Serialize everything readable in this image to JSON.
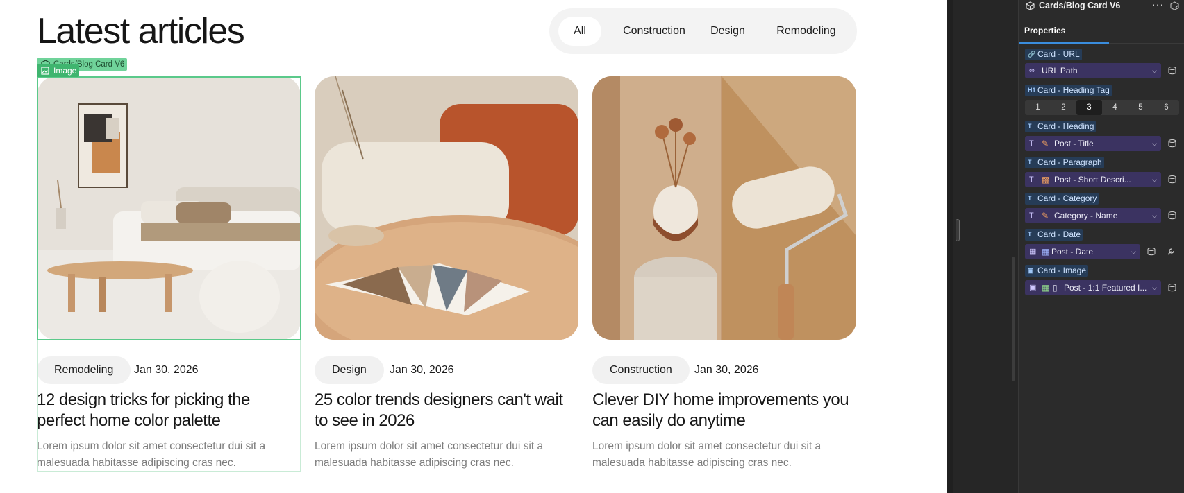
{
  "canvas": {
    "title": "Latest articles",
    "filters": [
      {
        "label": "All",
        "active": true
      },
      {
        "label": "Construction",
        "active": false
      },
      {
        "label": "Design",
        "active": false
      },
      {
        "label": "Remodeling",
        "active": false
      }
    ],
    "cards": [
      {
        "category": "Remodeling",
        "date": "Jan 30, 2026",
        "heading": "12 design tricks for picking the perfect home color palette",
        "paragraph": "Lorem ipsum dolor sit amet consectetur dui sit a malesuada habitasse adipiscing cras nec."
      },
      {
        "category": "Design",
        "date": "Jan 30, 2026",
        "heading": "25 color trends designers can't wait to see in 2026",
        "paragraph": "Lorem ipsum dolor sit amet consectetur dui sit a malesuada habitasse adipiscing cras nec."
      },
      {
        "category": "Construction",
        "date": "Jan 30, 2026",
        "heading": "Clever DIY home improvements you can easily do anytime",
        "paragraph": "Lorem ipsum dolor sit amet consectetur dui sit a malesuada habitasse adipiscing cras nec."
      }
    ],
    "selection": {
      "component_tag": "Cards/Blog Card V6",
      "element_tag": "Image"
    }
  },
  "panel": {
    "component_name": "Cards/Blog Card V6",
    "more_label": "···",
    "tab": "Properties",
    "heading_tag_options": [
      "1",
      "2",
      "3",
      "4",
      "5",
      "6"
    ],
    "heading_tag_selected": "3",
    "props": {
      "url": {
        "label": "Card - URL",
        "value": "URL Path"
      },
      "heading_tag": {
        "label": "Card - Heading Tag",
        "prefix": "H1"
      },
      "heading": {
        "label": "Card - Heading",
        "value": "Post - Title"
      },
      "paragraph": {
        "label": "Card - Paragraph",
        "value": "Post - Short Descri..."
      },
      "category": {
        "label": "Card - Category",
        "value": "Category - Name"
      },
      "date": {
        "label": "Card - Date",
        "value": "Post - Date"
      },
      "image": {
        "label": "Card - Image",
        "value": "Post - 1:1 Featured I..."
      }
    },
    "colors": {
      "accent": "#3a8dde",
      "field_bg": "#3b3361",
      "label_bg": "#263c57",
      "selection": "#3fb56f"
    }
  }
}
